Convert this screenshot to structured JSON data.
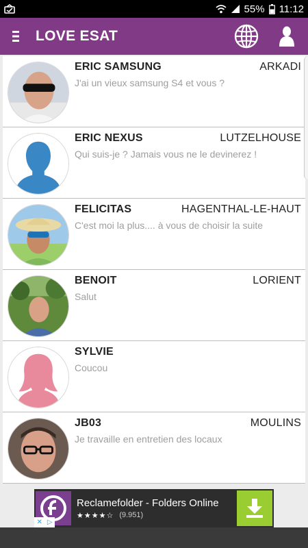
{
  "status_bar": {
    "battery": "55%",
    "time": "11:12"
  },
  "app_bar": {
    "title": "LOVE ESAT"
  },
  "profiles": [
    {
      "name": "ERIC SAMSUNG",
      "city": "ARKADI",
      "message": "J'ai un vieux samsung S4 et vous ?",
      "avatar": "photo-man-sunglasses"
    },
    {
      "name": "ERIC NEXUS",
      "city": "LUTZELHOUSE",
      "message": "Qui suis-je ? Jamais vous ne le devinerez !",
      "avatar": "male-silhouette"
    },
    {
      "name": "FELICITAS",
      "city": "HAGENTHAL-LE-HAUT",
      "message": "C'est moi la plus.... à vous de choisir la suite",
      "avatar": "photo-woman-straw-hat"
    },
    {
      "name": "BENOIT",
      "city": "LORIENT",
      "message": "Salut",
      "avatar": "photo-man-outdoors"
    },
    {
      "name": "SYLVIE",
      "city": "",
      "message": "Coucou",
      "avatar": "female-silhouette"
    },
    {
      "name": "JB03",
      "city": "MOULINS",
      "message": "Je travaille en entretien des locaux",
      "avatar": "photo-man-glasses"
    }
  ],
  "ad": {
    "title": "Reclamefolder - Folders Online",
    "stars": "★★★★☆",
    "rating_count": "(9.951)"
  },
  "colors": {
    "app_bar": "#813a86",
    "male_silhouette": "#3a87c6",
    "female_silhouette": "#e88a9c"
  }
}
